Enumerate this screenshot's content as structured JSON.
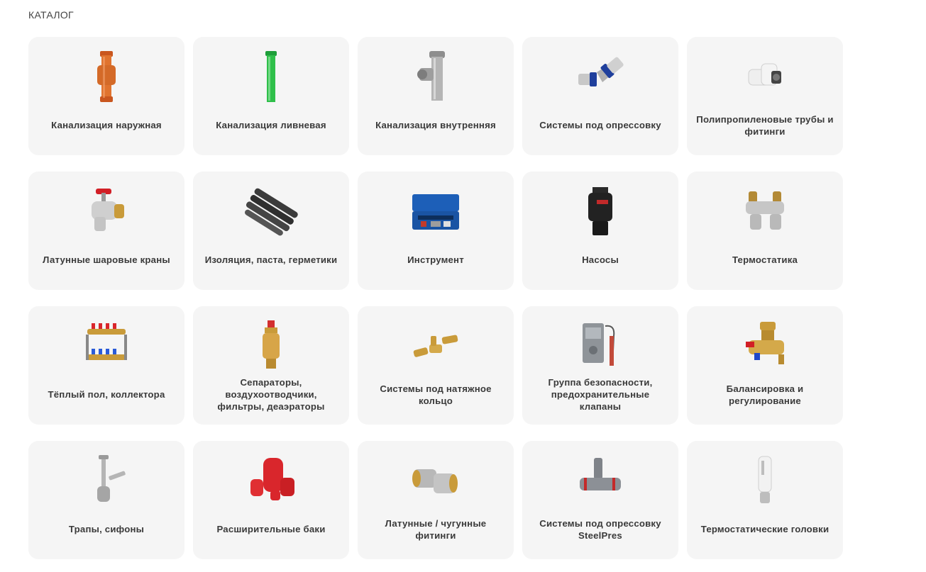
{
  "catalog": {
    "title": "КАТАЛОГ",
    "items": [
      {
        "label": "Канализация наружная",
        "icon": "orange-sewer-pipe-icon"
      },
      {
        "label": "Канализация ливневая",
        "icon": "green-drain-pipe-icon"
      },
      {
        "label": "Канализация внутренняя",
        "icon": "grey-sewer-tee-icon"
      },
      {
        "label": "Системы под опрессовку",
        "icon": "press-elbow-fitting-icon"
      },
      {
        "label": "Полипропиленовые трубы и фитинги",
        "icon": "white-pp-fitting-icon"
      },
      {
        "label": "Латунные шаровые краны",
        "icon": "brass-ball-valve-icon"
      },
      {
        "label": "Изоляция, паста, герметики",
        "icon": "foam-insulation-tubes-icon"
      },
      {
        "label": "Инструмент",
        "icon": "blue-tool-case-icon"
      },
      {
        "label": "Насосы",
        "icon": "circulation-pump-icon"
      },
      {
        "label": "Термостатика",
        "icon": "thermostatic-valve-icon"
      },
      {
        "label": "Тёплый пол, коллектора",
        "icon": "manifold-icon"
      },
      {
        "label": "Сепараторы, воздухоотводчики, фильтры, деаэраторы",
        "icon": "air-separator-icon"
      },
      {
        "label": "Системы под натяжное кольцо",
        "icon": "brass-ring-fittings-icon"
      },
      {
        "label": "Группа безопасности, предохранительные клапаны",
        "icon": "safety-thermostat-icon"
      },
      {
        "label": "Балансировка и регулирование",
        "icon": "balancing-valve-icon"
      },
      {
        "label": "Трапы, сифоны",
        "icon": "siphon-icon"
      },
      {
        "label": "Расширительные баки",
        "icon": "red-expansion-tanks-icon"
      },
      {
        "label": "Латунные / чугунные фитинги",
        "icon": "brass-elbow-icon"
      },
      {
        "label": "Системы под опрессовку SteelPres",
        "icon": "steel-press-tee-icon"
      },
      {
        "label": "Термостатические головки",
        "icon": "thermostatic-head-icon"
      }
    ]
  },
  "colors": {
    "card_bg": "#f5f5f5",
    "text": "#3a3a3a"
  }
}
